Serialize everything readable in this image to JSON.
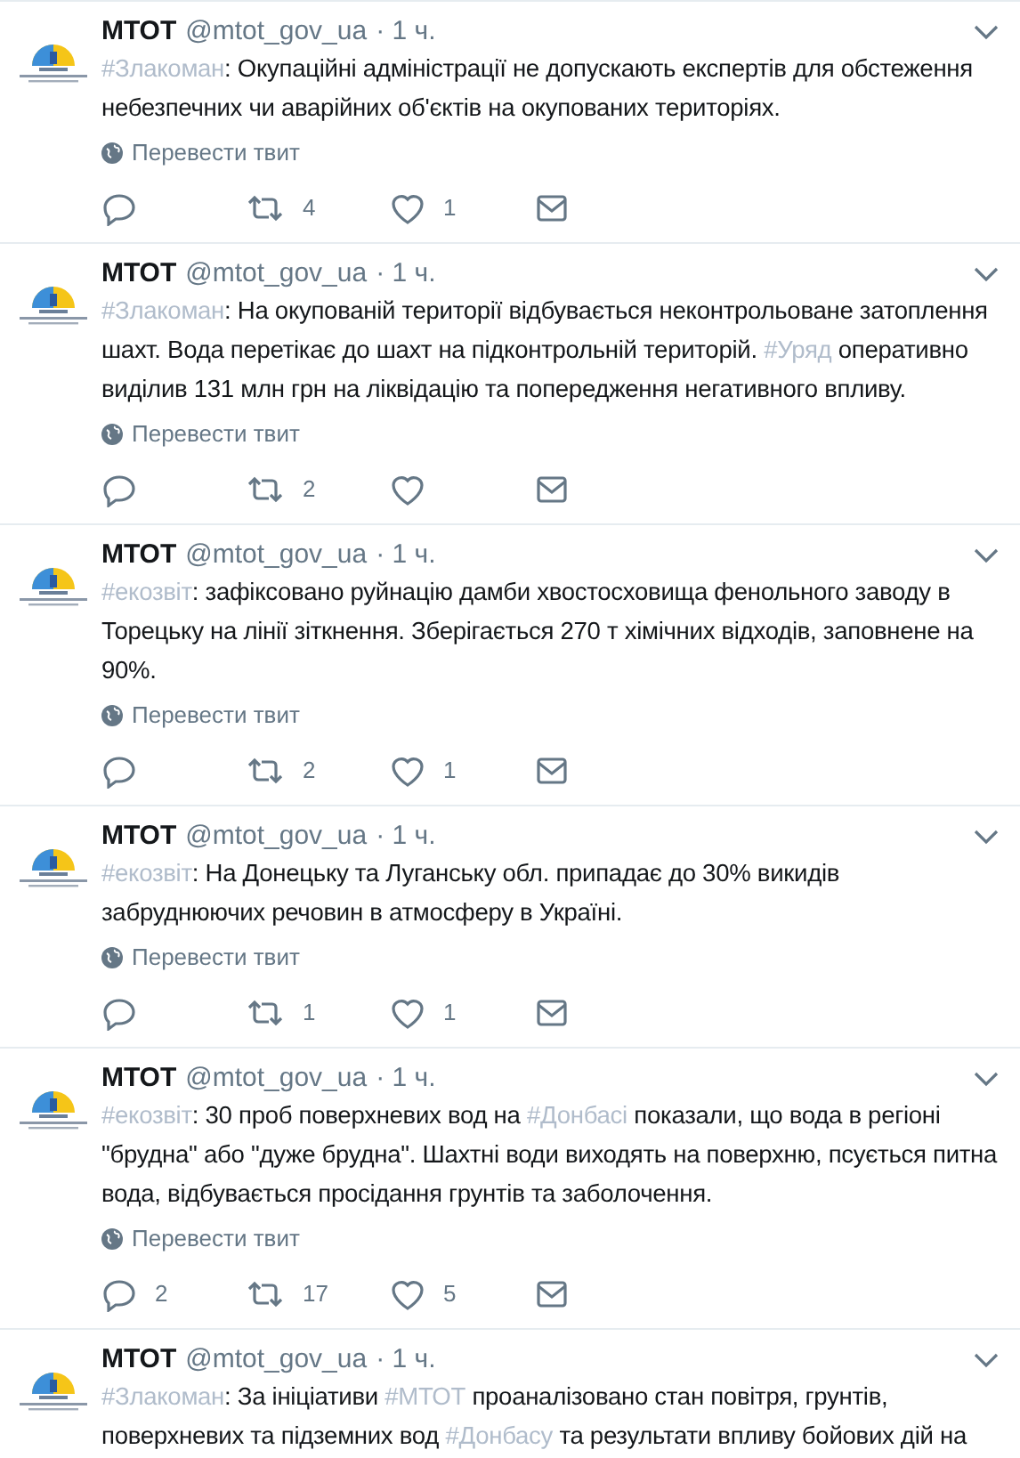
{
  "tweets": [
    {
      "name": "МТОТ",
      "handle": "@mtot_gov_ua",
      "time": "· 1 ч.",
      "text": [
        {
          "kind": "hashtag",
          "text": "#Злакоман"
        },
        {
          "kind": "plain",
          "text": ": Окупаційні адміністрації не допускають експертів для обстеження небезпечних чи аварійних об'єктів на окупованих територіях."
        }
      ],
      "translate": "Перевести твит",
      "retweets": "4",
      "likes": "1"
    },
    {
      "name": "МТОТ",
      "handle": "@mtot_gov_ua",
      "time": "· 1 ч.",
      "text": [
        {
          "kind": "hashtag",
          "text": "#Злакоман"
        },
        {
          "kind": "plain",
          "text": ": На окупованій території відбувається неконтрольоване затоплення шахт. Вода перетікає до шахт на підконтрольній територій. "
        },
        {
          "kind": "hashtag",
          "text": "#Уряд"
        },
        {
          "kind": "plain",
          "text": " оперативно виділив 131 млн грн на ліквідацію та попередження негативного впливу."
        }
      ],
      "translate": "Перевести твит",
      "retweets": "2"
    },
    {
      "name": "МТОТ",
      "handle": "@mtot_gov_ua",
      "time": "· 1 ч.",
      "text": [
        {
          "kind": "hashtag",
          "text": "#екозвіт"
        },
        {
          "kind": "plain",
          "text": ": зафіксовано руйнацію дамби хвостосховища фенольного заводу в Торецьку на лінії зіткнення. Зберігається 270 т хімічних відходів, заповнене на 90%."
        }
      ],
      "translate": "Перевести твит",
      "retweets": "2",
      "likes": "1"
    },
    {
      "name": "МТОТ",
      "handle": "@mtot_gov_ua",
      "time": "· 1 ч.",
      "text": [
        {
          "kind": "hashtag",
          "text": "#екозвіт"
        },
        {
          "kind": "plain",
          "text": ": На Донецьку та Луганську обл. припадає до 30% викидів забруднюючих речовин в атмосферу в Україні."
        }
      ],
      "translate": "Перевести твит",
      "retweets": "1",
      "likes": "1"
    },
    {
      "name": "МТОТ",
      "handle": "@mtot_gov_ua",
      "time": "· 1 ч.",
      "text": [
        {
          "kind": "hashtag",
          "text": "#екозвіт"
        },
        {
          "kind": "plain",
          "text": ": 30 проб поверхневих вод на "
        },
        {
          "kind": "hashtag",
          "text": "#Донбасі"
        },
        {
          "kind": "plain",
          "text": " показали, що вода в регіоні \"брудна\" або \"дуже брудна\". Шахтні води виходять на поверхню, псується питна вода, відбувається просідання грунтів та заболочення."
        }
      ],
      "translate": "Перевести твит",
      "replies": "2",
      "retweets": "17",
      "likes": "5"
    },
    {
      "name": "МТОТ",
      "handle": "@mtot_gov_ua",
      "time": "· 1 ч.",
      "text": [
        {
          "kind": "hashtag",
          "text": "#Злакоман"
        },
        {
          "kind": "plain",
          "text": ": За ініціативи "
        },
        {
          "kind": "hashtag",
          "text": "#МТОТ"
        },
        {
          "kind": "plain",
          "text": " проаналізовано стан повітря,  грунтів, поверхневих та підземних вод "
        },
        {
          "kind": "hashtag",
          "text": "#Донбасу"
        },
        {
          "kind": "plain",
          "text": " та результати впливу бойових дій на"
        }
      ]
    }
  ]
}
